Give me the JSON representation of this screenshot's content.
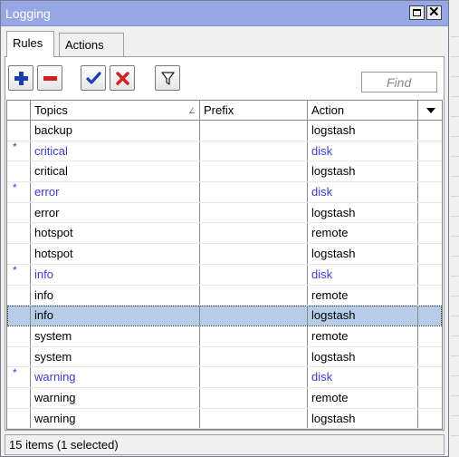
{
  "window": {
    "title": "Logging"
  },
  "tabs": [
    {
      "label": "Rules",
      "active": true
    },
    {
      "label": "Actions",
      "active": false
    }
  ],
  "toolbar": {
    "add_icon": "plus-icon",
    "remove_icon": "minus-icon",
    "enable_icon": "checkmark-icon",
    "disable_icon": "cross-icon",
    "filter_icon": "filter-icon"
  },
  "search": {
    "placeholder": "Find"
  },
  "table": {
    "columns": {
      "topics": "Topics",
      "prefix": "Prefix",
      "action": "Action"
    },
    "rows": [
      {
        "flag": "",
        "topics": "backup",
        "prefix": "",
        "action": "logstash",
        "disabled": false,
        "selected": false
      },
      {
        "flag": "*",
        "topics": "critical",
        "prefix": "",
        "action": "disk",
        "disabled": true,
        "selected": false
      },
      {
        "flag": "",
        "topics": "critical",
        "prefix": "",
        "action": "logstash",
        "disabled": false,
        "selected": false
      },
      {
        "flag": "*",
        "topics": "error",
        "prefix": "",
        "action": "disk",
        "disabled": true,
        "selected": false
      },
      {
        "flag": "",
        "topics": "error",
        "prefix": "",
        "action": "logstash",
        "disabled": false,
        "selected": false
      },
      {
        "flag": "",
        "topics": "hotspot",
        "prefix": "",
        "action": "remote",
        "disabled": false,
        "selected": false
      },
      {
        "flag": "",
        "topics": "hotspot",
        "prefix": "",
        "action": "logstash",
        "disabled": false,
        "selected": false
      },
      {
        "flag": "*",
        "topics": "info",
        "prefix": "",
        "action": "disk",
        "disabled": true,
        "selected": false
      },
      {
        "flag": "",
        "topics": "info",
        "prefix": "",
        "action": "remote",
        "disabled": false,
        "selected": false
      },
      {
        "flag": "",
        "topics": "info",
        "prefix": "",
        "action": "logstash",
        "disabled": false,
        "selected": true
      },
      {
        "flag": "",
        "topics": "system",
        "prefix": "",
        "action": "remote",
        "disabled": false,
        "selected": false
      },
      {
        "flag": "",
        "topics": "system",
        "prefix": "",
        "action": "logstash",
        "disabled": false,
        "selected": false
      },
      {
        "flag": "*",
        "topics": "warning",
        "prefix": "",
        "action": "disk",
        "disabled": true,
        "selected": false
      },
      {
        "flag": "",
        "topics": "warning",
        "prefix": "",
        "action": "remote",
        "disabled": false,
        "selected": false
      },
      {
        "flag": "",
        "topics": "warning",
        "prefix": "",
        "action": "logstash",
        "disabled": false,
        "selected": false
      }
    ]
  },
  "status": {
    "text": "15 items (1 selected)"
  },
  "colors": {
    "titlebar": "#97a7e6",
    "disabled_text": "#3b3bd0",
    "selected_row": "#b7cde7",
    "add_blue": "#1a3fb0",
    "remove_red": "#d41f1f"
  }
}
